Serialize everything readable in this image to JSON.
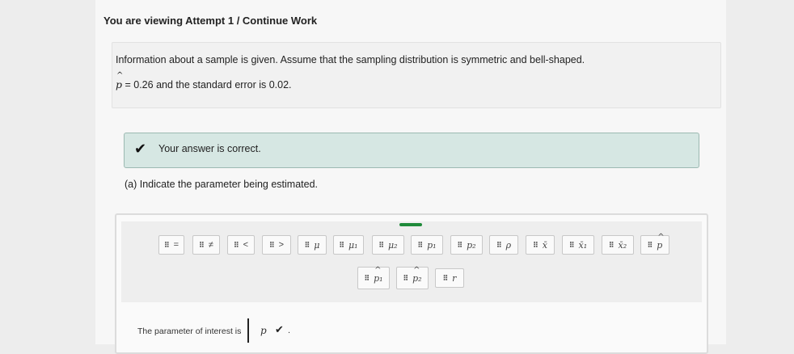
{
  "header": {
    "viewing_text": "You are viewing Attempt 1 / ",
    "continue_link": "Continue Work"
  },
  "info": {
    "line1": "Information about a sample is given. Assume that the sampling distribution is symmetric and bell-shaped.",
    "phat_symbol": "p",
    "line2_rest": " = 0.26 and the standard error is 0.02."
  },
  "feedback": {
    "icon": "check-icon",
    "message": "Your answer is correct."
  },
  "question": {
    "text": "(a) Indicate the parameter being estimated."
  },
  "palette": {
    "row1": [
      "=",
      "≠",
      "<",
      ">",
      "μ",
      "μ₁",
      "μ₂",
      "p₁",
      "p₂",
      "ρ",
      "x̄",
      "x̄₁",
      "x̄₂",
      "p"
    ],
    "row2": [
      "p₁",
      "p₂",
      "r"
    ]
  },
  "answer": {
    "label": "The parameter of interest is",
    "value": "p",
    "status": "correct",
    "end": "."
  }
}
